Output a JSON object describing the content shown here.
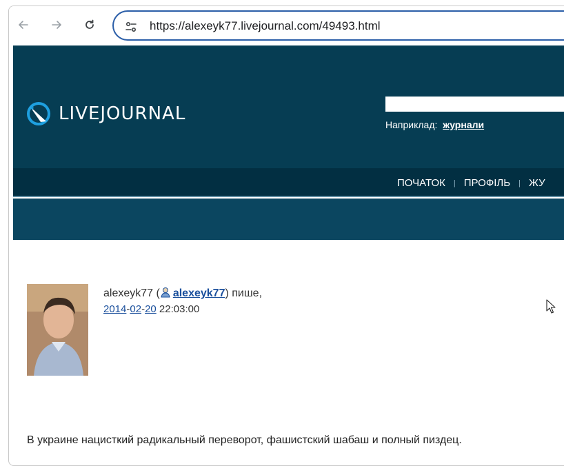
{
  "browser": {
    "url": "https://alexeyk77.livejournal.com/49493.html",
    "nav_icons": [
      "arrow-back-icon",
      "arrow-forward-icon",
      "reload-icon",
      "site-settings-icon"
    ]
  },
  "header": {
    "logo_text": "LIVEJOURNAL",
    "search_placeholder": "",
    "example_label": "Наприклад:",
    "example_link": "журнали",
    "colors": {
      "header_bg": "#063d53",
      "menubar_bg": "#022f42",
      "subbar_bg": "#0b4660"
    }
  },
  "menu": {
    "items": [
      "ПОЧАТОК",
      "ПРОФІЛЬ",
      "ЖУ"
    ]
  },
  "post": {
    "author_name": "alexeyk77",
    "open_paren": " (",
    "author_link": "alexeyk77",
    "writes": ") пише,",
    "date_year": "2014",
    "date_month": "02",
    "date_day": "20",
    "time": "22:03:00",
    "text": "В украине нацисткий радикальный переворот, фашистский шабаш и полный пиздец."
  }
}
